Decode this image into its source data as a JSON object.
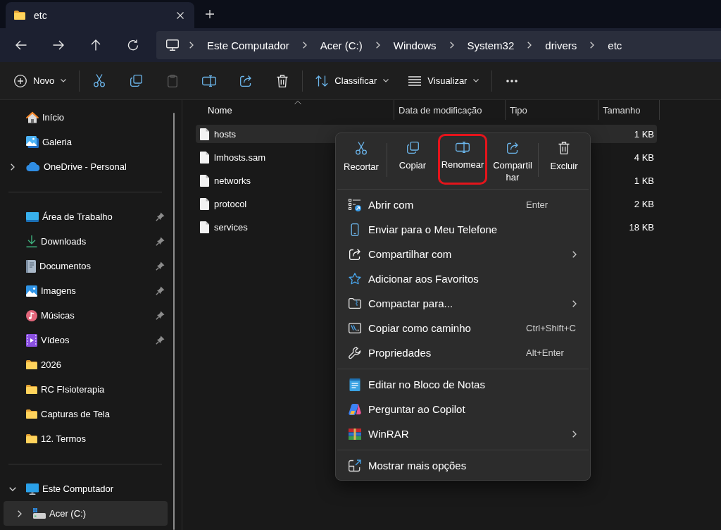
{
  "tab": {
    "title": "etc"
  },
  "address_bar": {
    "segments": [
      "Este Computador",
      "Acer (C:)",
      "Windows",
      "System32",
      "drivers",
      "etc"
    ]
  },
  "toolbar": {
    "groups": [
      {
        "items": [
          {
            "label": "Novo",
            "dropdown": true,
            "disabled": false
          }
        ]
      },
      {
        "items": [
          {
            "dropdown": false,
            "disabled": false
          },
          {
            "dropdown": false,
            "disabled": false
          },
          {
            "dropdown": false,
            "disabled": true
          },
          {
            "dropdown": false,
            "disabled": false
          },
          {
            "dropdown": false,
            "disabled": false
          },
          {
            "dropdown": false,
            "disabled": false
          }
        ]
      },
      {
        "items": [
          {
            "label": "Classificar",
            "dropdown": true,
            "disabled": false
          },
          {
            "label": "Visualizar",
            "dropdown": true,
            "disabled": false
          }
        ]
      },
      {
        "items": [
          {
            "dropdown": false,
            "disabled": false
          }
        ]
      }
    ]
  },
  "sidebar": {
    "sections": [
      {
        "items": [
          {
            "label": "Início",
            "pinned": false,
            "selected": false
          },
          {
            "label": "Galeria",
            "pinned": false,
            "selected": false
          },
          {
            "label": "OneDrive - Personal",
            "pinned": false,
            "selected": false,
            "expanded": false
          }
        ]
      },
      {
        "items": [
          {
            "label": "Área de Trabalho",
            "pinned": true,
            "selected": false
          },
          {
            "label": "Downloads",
            "pinned": true,
            "selected": false
          },
          {
            "label": "Documentos",
            "pinned": true,
            "selected": false
          },
          {
            "label": "Imagens",
            "pinned": true,
            "selected": false
          },
          {
            "label": "Músicas",
            "pinned": true,
            "selected": false
          },
          {
            "label": "Vídeos",
            "pinned": true,
            "selected": false
          },
          {
            "label": "2026",
            "pinned": false,
            "selected": false
          },
          {
            "label": "RC FIsioterapia",
            "pinned": false,
            "selected": false
          },
          {
            "label": "Capturas de Tela",
            "pinned": false,
            "selected": false
          },
          {
            "label": "12. Termos",
            "pinned": false,
            "selected": false
          }
        ]
      },
      {
        "items": [
          {
            "label": "Este Computador",
            "pinned": false,
            "selected": false,
            "expanded": true,
            "children": [
              {
                "label": "Acer (C:)",
                "pinned": false,
                "selected": true,
                "expanded": false
              }
            ]
          }
        ]
      }
    ]
  },
  "file_list": {
    "columns": [
      {
        "label": "Nome",
        "sorted": true
      },
      {
        "label": "Data de modificação",
        "sorted": false
      },
      {
        "label": "Tipo",
        "sorted": false
      },
      {
        "label": "Tamanho",
        "sorted": false
      }
    ],
    "rows": [
      {
        "name": "hosts",
        "size": "1 KB",
        "selected": true
      },
      {
        "name": "lmhosts.sam",
        "size": "4 KB",
        "selected": false
      },
      {
        "name": "networks",
        "size": "1 KB",
        "selected": false
      },
      {
        "name": "protocol",
        "size": "2 KB",
        "selected": false
      },
      {
        "name": "services",
        "size": "18 KB",
        "selected": false
      }
    ]
  },
  "context_menu": {
    "actions": [
      {
        "items": [
          {
            "label": "Recortar",
            "highlighted": false
          }
        ]
      },
      {
        "items": [
          {
            "label": "Copiar",
            "highlighted": false
          },
          {
            "label": "Renomear",
            "highlighted": true
          },
          {
            "label": "Compartilhar",
            "highlighted": false
          }
        ]
      },
      {
        "items": [
          {
            "label": "Excluir",
            "highlighted": false
          }
        ]
      }
    ],
    "groups": [
      {
        "items": [
          {
            "label": "Abrir com",
            "shortcut": "Enter",
            "submenu": false
          },
          {
            "label": "Enviar para o Meu Telefone",
            "submenu": false
          },
          {
            "label": "Compartilhar com",
            "submenu": true
          },
          {
            "label": "Adicionar aos Favoritos",
            "submenu": false
          },
          {
            "label": "Compactar para...",
            "submenu": true
          },
          {
            "label": "Copiar como caminho",
            "shortcut": "Ctrl+Shift+C",
            "submenu": false
          },
          {
            "label": "Propriedades",
            "shortcut": "Alt+Enter",
            "submenu": false
          }
        ]
      },
      {
        "items": [
          {
            "label": "Editar no Bloco de Notas",
            "submenu": false
          },
          {
            "label": "Perguntar ao Copilot",
            "submenu": false
          },
          {
            "label": "WinRAR",
            "submenu": true
          }
        ]
      },
      {
        "items": [
          {
            "label": "Mostrar mais opções",
            "submenu": false
          }
        ]
      }
    ]
  }
}
